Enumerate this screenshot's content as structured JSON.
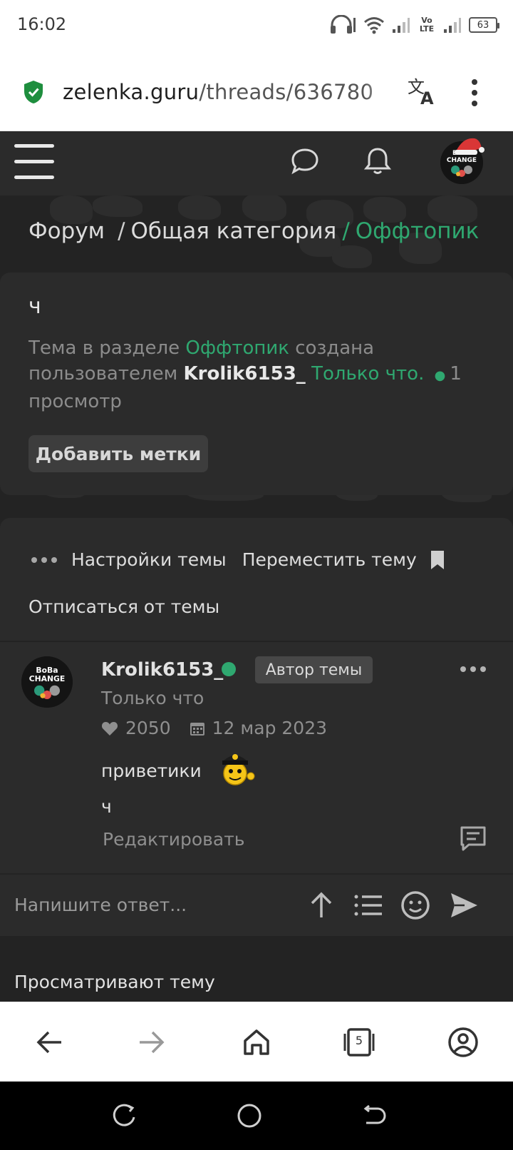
{
  "status_bar": {
    "time": "16:02",
    "battery": "63",
    "network": "Vo LTE"
  },
  "browser": {
    "url_host": "zelenka.guru",
    "url_path": "/threads/636780",
    "icons": [
      "shield-secure-icon",
      "translate-icon",
      "more-vert-icon"
    ]
  },
  "site_header": {
    "icons": [
      "hamburger-menu-icon",
      "chat-bubble-icon",
      "bell-icon",
      "user-avatar"
    ],
    "avatar_text": [
      "BoBa",
      "CHANGE"
    ]
  },
  "breadcrumb": {
    "items": [
      "Форум",
      "Общая категория",
      "Оффтопик"
    ],
    "separator": "/"
  },
  "thread": {
    "title": "ч",
    "meta_prefix": "Тема в разделе",
    "section": "Оффтопик",
    "meta_created": "создана пользователем",
    "author": "Krolik6153_",
    "time": "Только что.",
    "views": "1 просмотр",
    "add_tags_button": "Добавить метки"
  },
  "thread_actions": {
    "settings": "Настройки темы",
    "move": "Переместить тему",
    "unsubscribe": "Отписаться от темы"
  },
  "post": {
    "username": "Krolik6153_",
    "badge": "Автор темы",
    "time": "Только что",
    "likes": "2050",
    "registered": "12 мар 2023",
    "lines": [
      "приветики",
      "ч"
    ],
    "edit": "Редактировать"
  },
  "reply": {
    "placeholder": "Напишите ответ...",
    "icons": [
      "arrow-up-icon",
      "list-icon",
      "smile-icon",
      "send-icon"
    ]
  },
  "viewers": {
    "title": "Просматривают тему"
  },
  "browser_nav": {
    "tabs_count": "5"
  },
  "colors": {
    "accent": "#2fa870",
    "background": "#232323",
    "panel": "#2b2b2b"
  }
}
